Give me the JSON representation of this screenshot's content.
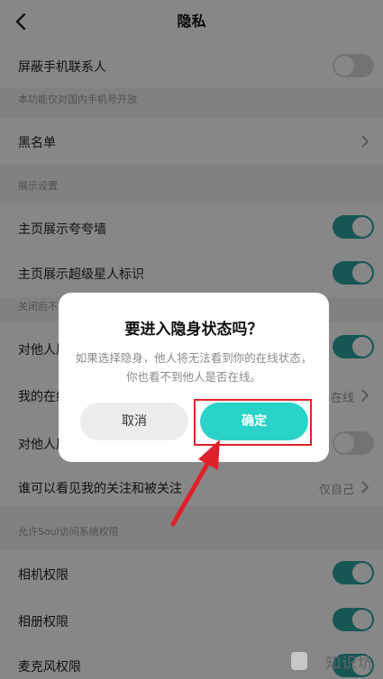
{
  "header": {
    "title": "隐私"
  },
  "rows": {
    "block_contacts": "屏蔽手机联系人",
    "block_contacts_hint": "本功能仅对国内手机号开放",
    "blacklist": "黑名单",
    "display_section": "展示设置",
    "homepage_kuakua": "主页展示夸夸墙",
    "homepage_superstar": "主页展示超级星人标识",
    "superstar_hint": "关闭后不",
    "row_a_label": "对他人展",
    "row_b_label": "我的在线",
    "row_b_value": "在线",
    "row_c_label": "对他人展",
    "follow_visibility": "谁可以看见我的关注和被关注",
    "follow_visibility_value": "仅自己",
    "permissions_section": "允许Soul访问系统权限",
    "camera": "相机权限",
    "album": "相册权限",
    "microphone": "麦克风权限"
  },
  "toggles": {
    "block_contacts": false,
    "homepage_kuakua": true,
    "homepage_superstar": true,
    "row_a": true,
    "row_c": false,
    "camera": true,
    "album": true,
    "microphone": true
  },
  "dialog": {
    "title": "要进入隐身状态吗？",
    "body": "如果选择隐身，他人将无法看到你的在线状态，你也看不到他人是否在线。",
    "cancel": "取消",
    "confirm": "确定"
  },
  "watermark": {
    "text": "知识坑"
  },
  "colors": {
    "accent": "#2aa59f",
    "confirm": "#2ad3c8",
    "highlight": "#e0202a"
  }
}
